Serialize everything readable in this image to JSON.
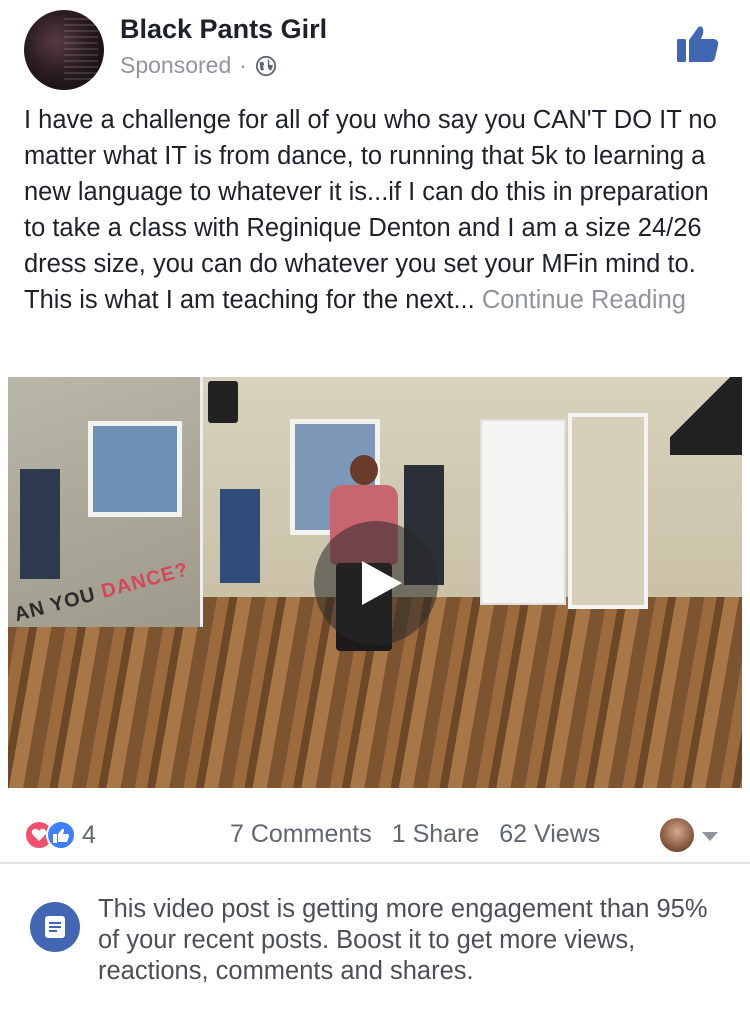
{
  "post": {
    "author": "Black Pants Girl",
    "sponsored_label": "Sponsored",
    "separator": "·",
    "privacy_icon": "globe-icon",
    "like_icon": "thumbs-up-icon",
    "text": "I have a challenge for all of you who say you CAN'T DO IT no matter what IT is from dance, to running that 5k to learning a new language to whatever it is...if I can do this in preparation to take a class with Reginique Denton and I am a size 24/26 dress size, you can do whatever you set your MFin mind to. This is what I am teaching for the next...",
    "continue_label": "Continue Reading"
  },
  "video": {
    "wall_text_left": "AN YOU",
    "wall_text_right": "DANCE?",
    "play_icon": "play-icon"
  },
  "stats": {
    "reaction_count": "4",
    "comments": "7 Comments",
    "shares": "1 Share",
    "views": "62 Views"
  },
  "insight": {
    "icon": "document-icon",
    "text": "This video post is getting more engagement than 95% of your recent posts. Boost it to get more views, reactions, comments and shares."
  },
  "colors": {
    "facebook_blue": "#4267b2",
    "like_blue": "#4080ff",
    "love_red": "#f0506e",
    "muted_text": "#90949c"
  }
}
